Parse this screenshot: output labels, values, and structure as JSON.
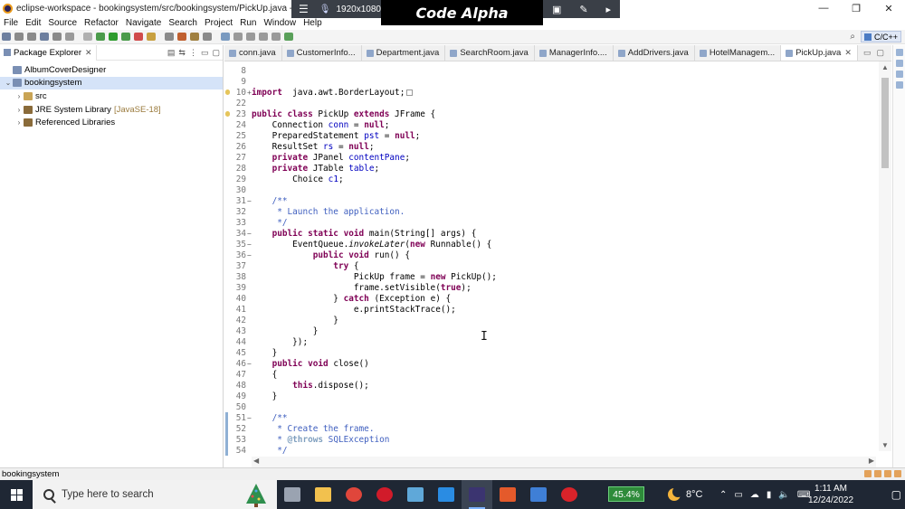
{
  "window": {
    "title": "eclipse-workspace - bookingsystem/src/bookingsystem/PickUp.java - Ec",
    "controls": {
      "minimize": "—",
      "maximize": "❐",
      "close": "✕"
    }
  },
  "overlay": {
    "resolution": "1920x1080",
    "brand": "Code Alpha"
  },
  "menu": [
    "File",
    "Edit",
    "Source",
    "Refactor",
    "Navigate",
    "Search",
    "Project",
    "Run",
    "Window",
    "Help"
  ],
  "perspective": {
    "label": "C/C++"
  },
  "package_explorer": {
    "title": "Package Explorer",
    "items": [
      {
        "label": "AlbumCoverDesigner",
        "indent": 0,
        "arrow": "",
        "icon_color": "#7a8fb4",
        "selected": false
      },
      {
        "label": "bookingsystem",
        "indent": 0,
        "arrow": "⌄",
        "icon_color": "#7a8fb4",
        "selected": true
      },
      {
        "label": "src",
        "indent": 1,
        "arrow": "›",
        "icon_color": "#c9a455",
        "selected": false
      },
      {
        "label": "JRE System Library",
        "sub": "[JavaSE-18]",
        "indent": 1,
        "arrow": "›",
        "icon_color": "#8a6b3a",
        "selected": false
      },
      {
        "label": "Referenced Libraries",
        "indent": 1,
        "arrow": "›",
        "icon_color": "#8a6b3a",
        "selected": false
      }
    ]
  },
  "editor": {
    "tabs": [
      {
        "label": "conn.java",
        "active": false
      },
      {
        "label": "CustomerInfo...",
        "active": false
      },
      {
        "label": "Department.java",
        "active": false
      },
      {
        "label": "SearchRoom.java",
        "active": false
      },
      {
        "label": "ManagerInfo....",
        "active": false
      },
      {
        "label": "AddDrivers.java",
        "active": false
      },
      {
        "label": "HotelManagem...",
        "active": false
      },
      {
        "label": "PickUp.java",
        "active": true
      }
    ],
    "lines": [
      {
        "n": "8",
        "marker": "",
        "fold": "",
        "segs": []
      },
      {
        "n": "9",
        "marker": "",
        "fold": "",
        "segs": []
      },
      {
        "n": "10",
        "marker": "bulb",
        "fold": "+",
        "segs": [
          [
            "kw",
            "import"
          ],
          [
            "",
            "  java.awt.BorderLayout;"
          ]
        ],
        "box": true
      },
      {
        "n": "22",
        "marker": "",
        "fold": "",
        "segs": []
      },
      {
        "n": "23",
        "marker": "bulb",
        "fold": "",
        "segs": [
          [
            "kw",
            "public class"
          ],
          [
            "",
            " PickUp "
          ],
          [
            "kw",
            "extends"
          ],
          [
            "",
            " JFrame {"
          ]
        ]
      },
      {
        "n": "24",
        "marker": "",
        "fold": "",
        "segs": [
          [
            "",
            "    Connection "
          ],
          [
            "fld",
            "conn"
          ],
          [
            "",
            " = "
          ],
          [
            "kw",
            "null"
          ],
          [
            "",
            ";"
          ]
        ]
      },
      {
        "n": "25",
        "marker": "",
        "fold": "",
        "segs": [
          [
            "",
            "    PreparedStatement "
          ],
          [
            "fld",
            "pst"
          ],
          [
            "",
            " = "
          ],
          [
            "kw",
            "null"
          ],
          [
            "",
            ";"
          ]
        ]
      },
      {
        "n": "26",
        "marker": "",
        "fold": "",
        "segs": [
          [
            "",
            "    ResultSet "
          ],
          [
            "fld",
            "rs"
          ],
          [
            "",
            " = "
          ],
          [
            "kw",
            "null"
          ],
          [
            "",
            ";"
          ]
        ]
      },
      {
        "n": "27",
        "marker": "",
        "fold": "",
        "segs": [
          [
            "kw",
            "    private"
          ],
          [
            "",
            " JPanel "
          ],
          [
            "fld",
            "contentPane"
          ],
          [
            "",
            ";"
          ]
        ]
      },
      {
        "n": "28",
        "marker": "",
        "fold": "",
        "segs": [
          [
            "kw",
            "    private"
          ],
          [
            "",
            " JTable "
          ],
          [
            "fld",
            "table"
          ],
          [
            "",
            ";"
          ]
        ]
      },
      {
        "n": "29",
        "marker": "",
        "fold": "",
        "segs": [
          [
            "",
            "        Choice "
          ],
          [
            "fld",
            "c1"
          ],
          [
            "",
            ";"
          ]
        ]
      },
      {
        "n": "30",
        "marker": "",
        "fold": "",
        "segs": []
      },
      {
        "n": "31",
        "marker": "",
        "fold": "−",
        "segs": [
          [
            "cmt",
            "    /**"
          ]
        ]
      },
      {
        "n": "32",
        "marker": "",
        "fold": "",
        "segs": [
          [
            "cmt",
            "     * Launch the application."
          ]
        ]
      },
      {
        "n": "33",
        "marker": "",
        "fold": "",
        "segs": [
          [
            "cmt",
            "     */"
          ]
        ]
      },
      {
        "n": "34",
        "marker": "",
        "fold": "−",
        "segs": [
          [
            "kw",
            "    public static void"
          ],
          [
            "",
            " main(String[] "
          ],
          [
            "",
            "args) {"
          ]
        ]
      },
      {
        "n": "35",
        "marker": "",
        "fold": "−",
        "segs": [
          [
            "",
            "        EventQueue."
          ],
          [
            "it",
            "invokeLater"
          ],
          [
            "",
            "("
          ],
          [
            "kw",
            "new"
          ],
          [
            "",
            " Runnable() {"
          ]
        ]
      },
      {
        "n": "36",
        "marker": "",
        "fold": "−",
        "segs": [
          [
            "kw",
            "            public void"
          ],
          [
            "",
            " run() {"
          ]
        ]
      },
      {
        "n": "37",
        "marker": "",
        "fold": "",
        "segs": [
          [
            "kw",
            "                try"
          ],
          [
            "",
            " {"
          ]
        ]
      },
      {
        "n": "38",
        "marker": "",
        "fold": "",
        "segs": [
          [
            "",
            "                    PickUp frame = "
          ],
          [
            "kw",
            "new"
          ],
          [
            "",
            " PickUp();"
          ]
        ]
      },
      {
        "n": "39",
        "marker": "",
        "fold": "",
        "segs": [
          [
            "",
            "                    frame.setVisible("
          ],
          [
            "kw",
            "true"
          ],
          [
            "",
            ");"
          ]
        ]
      },
      {
        "n": "40",
        "marker": "",
        "fold": "",
        "segs": [
          [
            "",
            "                } "
          ],
          [
            "kw",
            "catch"
          ],
          [
            "",
            " (Exception e) {"
          ]
        ]
      },
      {
        "n": "41",
        "marker": "",
        "fold": "",
        "segs": [
          [
            "",
            "                    e.printStackTrace();"
          ]
        ]
      },
      {
        "n": "42",
        "marker": "",
        "fold": "",
        "segs": [
          [
            "",
            "                }"
          ]
        ]
      },
      {
        "n": "43",
        "marker": "",
        "fold": "",
        "segs": [
          [
            "",
            "            }"
          ]
        ]
      },
      {
        "n": "44",
        "marker": "",
        "fold": "",
        "segs": [
          [
            "",
            "        });"
          ]
        ]
      },
      {
        "n": "45",
        "marker": "",
        "fold": "",
        "segs": [
          [
            "",
            "    }"
          ]
        ]
      },
      {
        "n": "46",
        "marker": "",
        "fold": "−",
        "segs": [
          [
            "kw",
            "    public void"
          ],
          [
            "",
            " close()"
          ]
        ]
      },
      {
        "n": "47",
        "marker": "",
        "fold": "",
        "segs": [
          [
            "",
            "    {"
          ]
        ]
      },
      {
        "n": "48",
        "marker": "",
        "fold": "",
        "segs": [
          [
            "kw",
            "        this"
          ],
          [
            "",
            ".dispose();"
          ]
        ]
      },
      {
        "n": "49",
        "marker": "",
        "fold": "",
        "segs": [
          [
            "",
            "    }"
          ]
        ]
      },
      {
        "n": "50",
        "marker": "",
        "fold": "",
        "segs": []
      },
      {
        "n": "51",
        "marker": "bar",
        "fold": "−",
        "segs": [
          [
            "cmt",
            "    /**"
          ]
        ]
      },
      {
        "n": "52",
        "marker": "bar",
        "fold": "",
        "segs": [
          [
            "cmt",
            "     * Create the frame."
          ]
        ]
      },
      {
        "n": "53",
        "marker": "bar",
        "fold": "",
        "segs": [
          [
            "cmt",
            "     * "
          ],
          [
            "tag",
            "@throws"
          ],
          [
            "cmt",
            " SQLException"
          ]
        ]
      },
      {
        "n": "54",
        "marker": "bar",
        "fold": "",
        "segs": [
          [
            "cmt",
            "     */"
          ]
        ]
      }
    ]
  },
  "statusbar": {
    "text": "bookingsystem"
  },
  "taskbar": {
    "search_placeholder": "Type here to search",
    "apps": [
      {
        "name": "task-view",
        "color": "#9aa3b1",
        "active": false
      },
      {
        "name": "file-explorer",
        "color": "#f2c14e",
        "active": false
      },
      {
        "name": "chrome",
        "color": "#e0463b",
        "active": false
      },
      {
        "name": "opera",
        "color": "#d11b2a",
        "active": false
      },
      {
        "name": "notepad",
        "color": "#5fa8d9",
        "active": false
      },
      {
        "name": "vscode",
        "color": "#2a8ce3",
        "active": false
      },
      {
        "name": "eclipse",
        "color": "#3b3470",
        "active": true
      },
      {
        "name": "office",
        "color": "#e45a2b",
        "active": false
      },
      {
        "name": "photos",
        "color": "#3f7fd6",
        "active": false
      },
      {
        "name": "recorder",
        "color": "#d8232a",
        "active": false
      }
    ],
    "battery": "45.4%",
    "temperature": "8°C",
    "time": "1:11 AM",
    "date": "12/24/2022"
  }
}
